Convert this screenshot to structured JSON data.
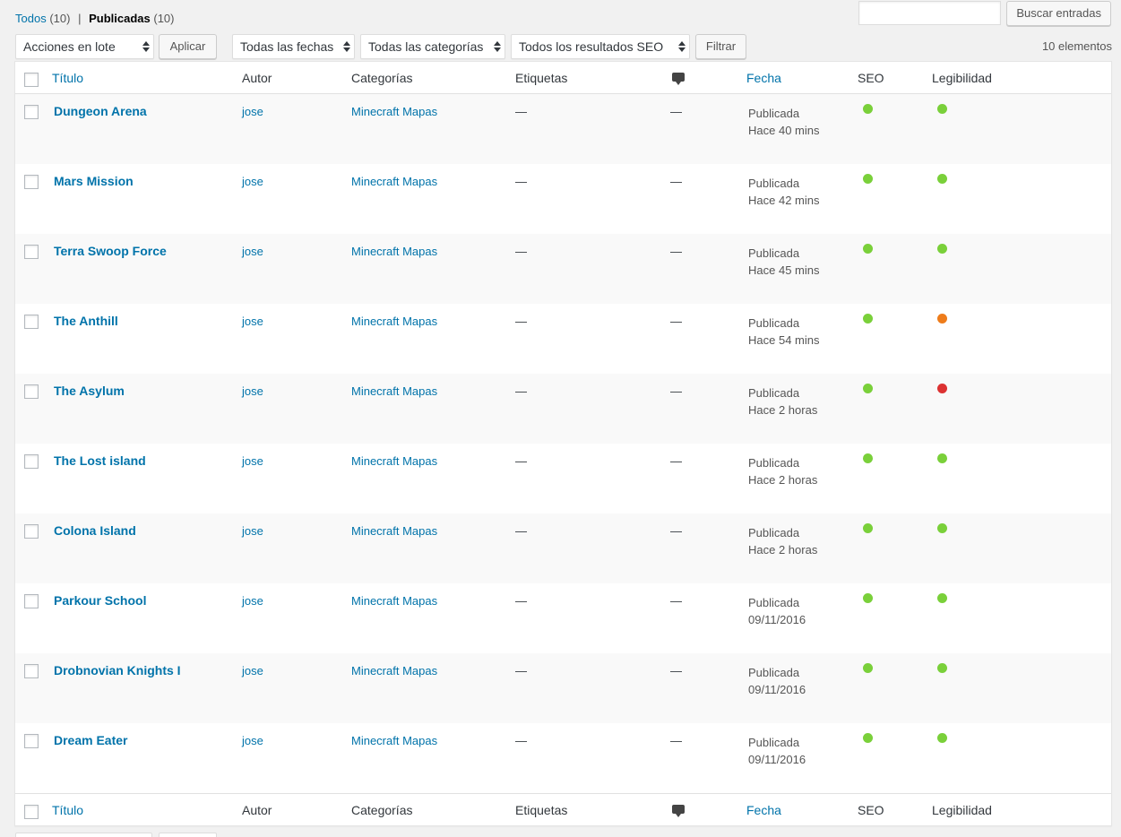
{
  "filters": {
    "all_label": "Todos",
    "all_count": "(10)",
    "separator": "|",
    "published_label": "Publicadas",
    "published_count": "(10)"
  },
  "search": {
    "placeholder": "",
    "button_label": "Buscar entradas"
  },
  "tablenav": {
    "bulk_actions": "Acciones en lote",
    "apply_label": "Aplicar",
    "dates": "Todas las fechas",
    "categories": "Todas las categorías",
    "seo": "Todos los resultados SEO",
    "filter_label": "Filtrar",
    "items_count": "10 elementos"
  },
  "columns": {
    "title": "Título",
    "author": "Autor",
    "categories": "Categorías",
    "tags": "Etiquetas",
    "comments_icon": "comment-bubble-icon",
    "date": "Fecha",
    "seo": "SEO",
    "readability": "Legibilidad"
  },
  "status_colors": {
    "good": "#7ad03a",
    "ok": "#ee7c1b",
    "bad": "#dc3232"
  },
  "posts": [
    {
      "title": "Dungeon Arena",
      "author": "jose",
      "category": "Minecraft Mapas",
      "tags": "—",
      "comments": "—",
      "status": "Publicada",
      "date": "Hace 40 mins",
      "seo": "good",
      "readability": "good"
    },
    {
      "title": "Mars Mission",
      "author": "jose",
      "category": "Minecraft Mapas",
      "tags": "—",
      "comments": "—",
      "status": "Publicada",
      "date": "Hace 42 mins",
      "seo": "good",
      "readability": "good"
    },
    {
      "title": "Terra Swoop Force",
      "author": "jose",
      "category": "Minecraft Mapas",
      "tags": "—",
      "comments": "—",
      "status": "Publicada",
      "date": "Hace 45 mins",
      "seo": "good",
      "readability": "good"
    },
    {
      "title": "The Anthill",
      "author": "jose",
      "category": "Minecraft Mapas",
      "tags": "—",
      "comments": "—",
      "status": "Publicada",
      "date": "Hace 54 mins",
      "seo": "good",
      "readability": "ok"
    },
    {
      "title": "The Asylum",
      "author": "jose",
      "category": "Minecraft Mapas",
      "tags": "—",
      "comments": "—",
      "status": "Publicada",
      "date": "Hace 2 horas",
      "seo": "good",
      "readability": "bad"
    },
    {
      "title": "The Lost island",
      "author": "jose",
      "category": "Minecraft Mapas",
      "tags": "—",
      "comments": "—",
      "status": "Publicada",
      "date": "Hace 2 horas",
      "seo": "good",
      "readability": "good"
    },
    {
      "title": "Colona Island",
      "author": "jose",
      "category": "Minecraft Mapas",
      "tags": "—",
      "comments": "—",
      "status": "Publicada",
      "date": "Hace 2 horas",
      "seo": "good",
      "readability": "good"
    },
    {
      "title": "Parkour School",
      "author": "jose",
      "category": "Minecraft Mapas",
      "tags": "—",
      "comments": "—",
      "status": "Publicada",
      "date": "09/11/2016",
      "seo": "good",
      "readability": "good"
    },
    {
      "title": "Drobnovian Knights I",
      "author": "jose",
      "category": "Minecraft Mapas",
      "tags": "—",
      "comments": "—",
      "status": "Publicada",
      "date": "09/11/2016",
      "seo": "good",
      "readability": "good"
    },
    {
      "title": "Dream Eater",
      "author": "jose",
      "category": "Minecraft Mapas",
      "tags": "—",
      "comments": "—",
      "status": "Publicada",
      "date": "09/11/2016",
      "seo": "good",
      "readability": "good"
    }
  ]
}
